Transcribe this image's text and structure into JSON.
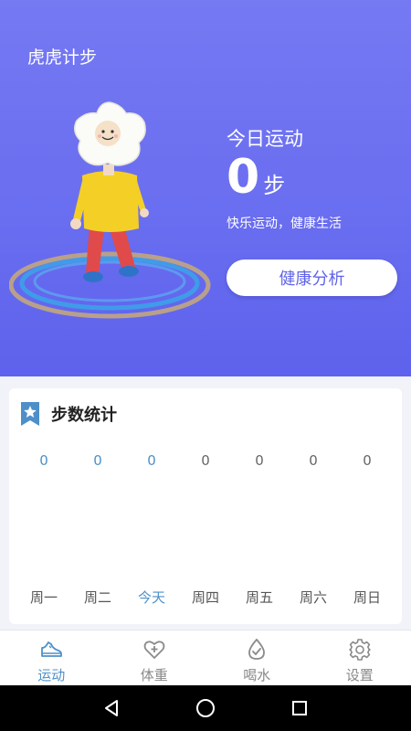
{
  "header": {
    "app_title": "虎虎计步"
  },
  "today": {
    "title": "今日运动",
    "steps": "0",
    "unit": "步",
    "slogan": "快乐运动，健康生活",
    "analysis_button": "健康分析"
  },
  "stats_card": {
    "title": "步数统计",
    "chart_data": {
      "type": "bar",
      "categories": [
        "周一",
        "周二",
        "今天",
        "周四",
        "周五",
        "周六",
        "周日"
      ],
      "values": [
        0,
        0,
        0,
        0,
        0,
        0,
        0
      ],
      "value_labels": [
        "0",
        "0",
        "0",
        "0",
        "0",
        "0",
        "0"
      ],
      "highlight_index": 2,
      "highlight_color": "#4e90c9"
    }
  },
  "tabbar": {
    "items": [
      {
        "label": "运动",
        "icon": "sneaker-icon",
        "active": true
      },
      {
        "label": "体重",
        "icon": "heart-plus-icon",
        "active": false
      },
      {
        "label": "喝水",
        "icon": "water-check-icon",
        "active": false
      },
      {
        "label": "设置",
        "icon": "gear-icon",
        "active": false
      }
    ]
  },
  "colors": {
    "accent": "#4e90c9",
    "hero_gradient_top": "#7579f2",
    "hero_gradient_bottom": "#5e62ec"
  }
}
